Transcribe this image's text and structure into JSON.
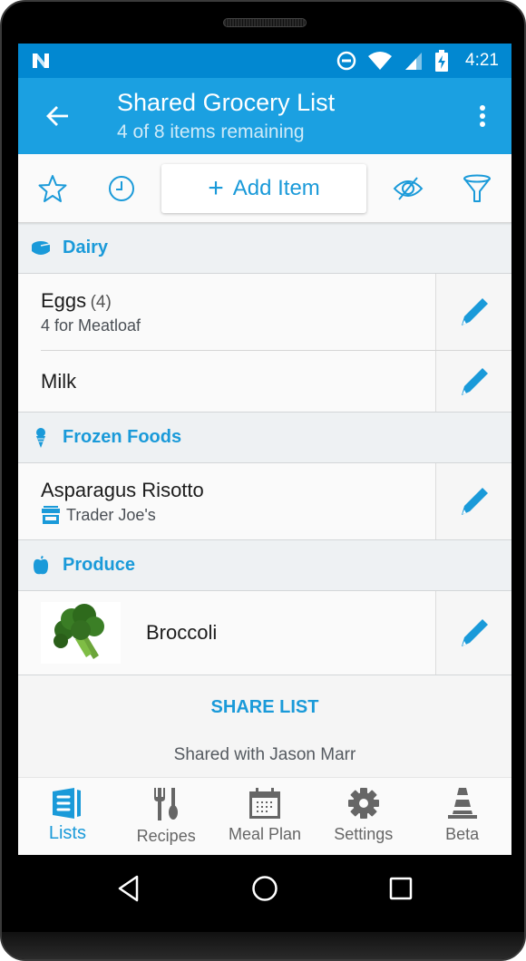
{
  "status_bar": {
    "notification_icon": "n-logo-icon",
    "icons": [
      "do-not-disturb-icon",
      "wifi-icon",
      "signal-icon",
      "battery-charging-icon"
    ],
    "time": "4:21"
  },
  "app_bar": {
    "title": "Shared Grocery List",
    "subtitle": "4 of 8 items remaining",
    "back_icon": "arrow-left-icon",
    "menu_icon": "more-vert-icon"
  },
  "toolbar": {
    "favorite_icon": "star-icon",
    "history_icon": "clock-icon",
    "add_item_label": "Add Item",
    "add_item_icon": "plus-icon",
    "hide_icon": "eye-off-icon",
    "filter_icon": "filter-icon"
  },
  "sections": [
    {
      "name": "Dairy",
      "icon": "cheese-icon",
      "items": [
        {
          "name": "Eggs",
          "quantity": "(4)",
          "note": "4 for Meatloaf"
        },
        {
          "name": "Milk"
        }
      ]
    },
    {
      "name": "Frozen Foods",
      "icon": "ice-cream-icon",
      "items": [
        {
          "name": "Asparagus Risotto",
          "store": "Trader Joe's",
          "store_icon": "store-icon"
        }
      ]
    },
    {
      "name": "Produce",
      "icon": "apple-icon",
      "items": [
        {
          "name": "Broccoli",
          "image": "broccoli-photo"
        }
      ]
    }
  ],
  "edit_icon": "pencil-icon",
  "share": {
    "button_label": "SHARE LIST",
    "shared_with": "Shared with Jason Marr"
  },
  "bottom_nav": {
    "active": "Lists",
    "items": [
      {
        "label": "Lists",
        "icon": "lists-icon"
      },
      {
        "label": "Recipes",
        "icon": "fork-spoon-icon"
      },
      {
        "label": "Meal Plan",
        "icon": "calendar-icon"
      },
      {
        "label": "Settings",
        "icon": "gear-icon"
      },
      {
        "label": "Beta",
        "icon": "traffic-cone-icon"
      }
    ]
  },
  "system_nav": [
    "back-triangle-icon",
    "home-circle-icon",
    "recents-square-icon"
  ],
  "colors": {
    "accent": "#1a9ad9",
    "status_bar": "#0288d1",
    "app_bar": "#1ba0e1",
    "section_bg": "#eef1f3"
  }
}
